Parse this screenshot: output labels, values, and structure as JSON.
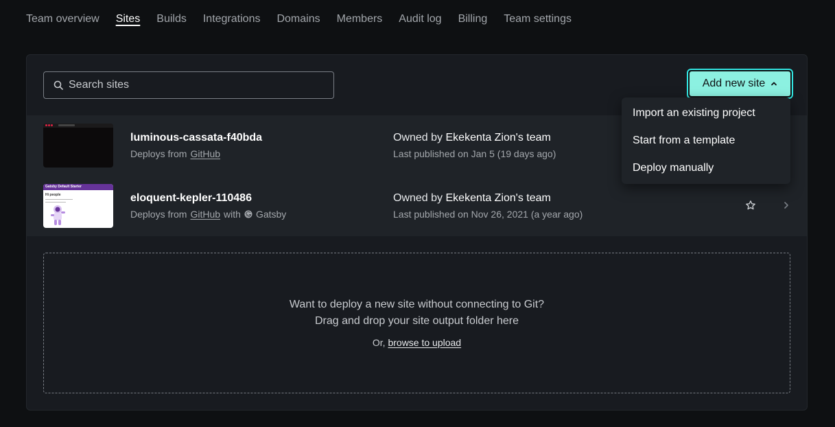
{
  "nav": {
    "tabs": [
      {
        "label": "Team overview"
      },
      {
        "label": "Sites"
      },
      {
        "label": "Builds"
      },
      {
        "label": "Integrations"
      },
      {
        "label": "Domains"
      },
      {
        "label": "Members"
      },
      {
        "label": "Audit log"
      },
      {
        "label": "Billing"
      },
      {
        "label": "Team settings"
      }
    ],
    "active": "Sites"
  },
  "search": {
    "placeholder": "Search sites",
    "icon": "search-icon"
  },
  "add_site": {
    "label": "Add new site",
    "icon": "chevron-up-icon"
  },
  "menu": {
    "items": [
      {
        "label": "Import an existing project"
      },
      {
        "label": "Start from a template"
      },
      {
        "label": "Deploy manually"
      }
    ]
  },
  "sites": [
    {
      "name": "luminous-cassata-f40bda",
      "deploys_prefix": "Deploys from",
      "provider": "GitHub",
      "owner_prefix": "Owned by",
      "owner": "Ekekenta Zion's team",
      "published": "Last published on Jan 5 (19 days ago)"
    },
    {
      "name": "eloquent-kepler-110486",
      "deploys_prefix": "Deploys from",
      "provider": "GitHub",
      "with_label": "with",
      "framework": "Gatsby",
      "owner_prefix": "Owned by",
      "owner": "Ekekenta Zion's team",
      "published": "Last published on Nov 26, 2021 (a year ago)",
      "thumb": {
        "header": "Gatsby Default Starter",
        "greeting": "Hi people"
      }
    }
  ],
  "dropzone": {
    "line1": "Want to deploy a new site without connecting to Git?",
    "line2": "Drag and drop your site output folder here",
    "or": "Or,",
    "link": "browse to upload"
  },
  "colors": {
    "background": "#0e1012",
    "panel": "#181b20",
    "accent": "#8cf1e1",
    "accent_border": "#32e6e2"
  }
}
